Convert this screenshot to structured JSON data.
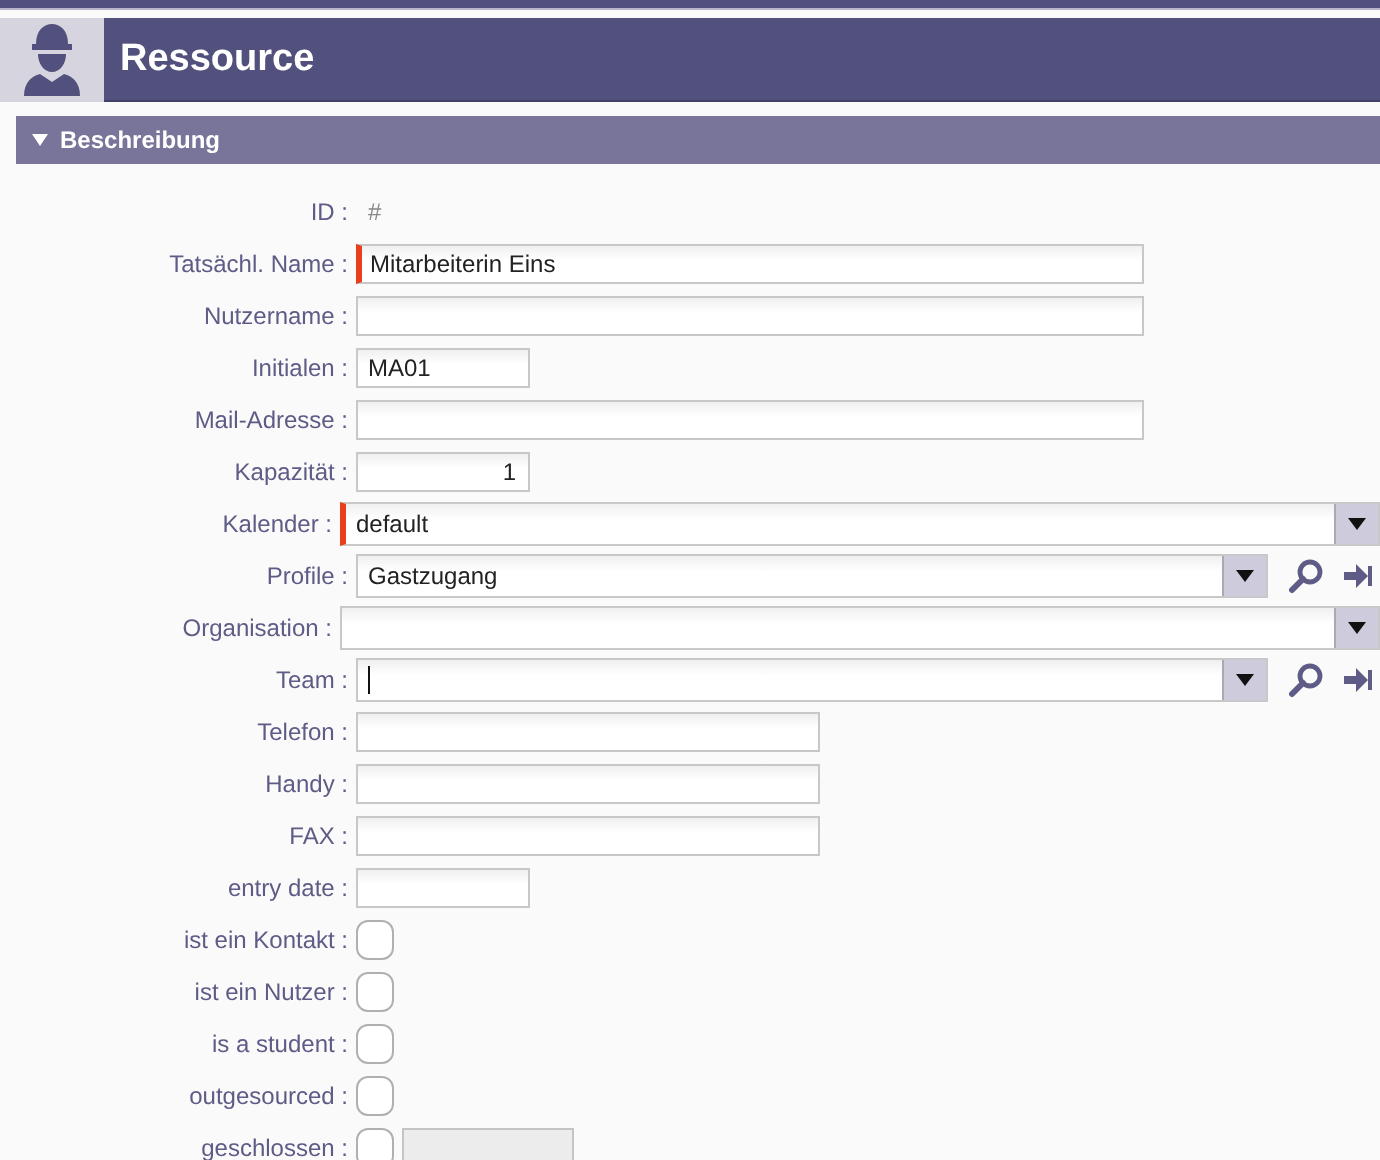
{
  "header": {
    "title": "Ressource"
  },
  "section": {
    "title": "Beschreibung",
    "expanded": true
  },
  "fields": [
    {
      "label": "ID :",
      "kind": "readonly",
      "value": "#"
    },
    {
      "label": "Tatsächl. Name :",
      "kind": "widetext",
      "value": "Mitarbeiterin Eins",
      "required": true
    },
    {
      "label": "Nutzername :",
      "kind": "widetext",
      "required": false
    },
    {
      "label": "Initialen :",
      "kind": "shorttext",
      "value": "MA01",
      "required": false
    },
    {
      "label": "Mail-Adresse :",
      "kind": "widetext",
      "required": false
    },
    {
      "label": "Kapazität :",
      "kind": "number",
      "value": "1",
      "required": false
    },
    {
      "label": "Kalender :",
      "kind": "select",
      "value": "default",
      "required": true
    },
    {
      "label": "Profile :",
      "kind": "lookup",
      "value": "Gastzugang",
      "required": false,
      "focused": false
    },
    {
      "label": "Organisation :",
      "kind": "select",
      "required": false
    },
    {
      "label": "Team :",
      "kind": "lookup",
      "required": false,
      "focused": true
    },
    {
      "label": "Telefon :",
      "kind": "midtext",
      "required": false
    },
    {
      "label": "Handy :",
      "kind": "midtext",
      "required": false
    },
    {
      "label": "FAX :",
      "kind": "midtext",
      "required": false
    },
    {
      "label": "entry date :",
      "kind": "shorttext",
      "required": false
    },
    {
      "label": "ist ein Kontakt :",
      "kind": "checkbox",
      "checked": false
    },
    {
      "label": "ist ein Nutzer :",
      "kind": "checkbox",
      "checked": false
    },
    {
      "label": "is a student :",
      "kind": "checkbox",
      "checked": false
    },
    {
      "label": "outgesourced :",
      "kind": "checkbox",
      "checked": false
    },
    {
      "label": "geschlossen :",
      "kind": "checkboxfield",
      "checked": false
    }
  ]
}
